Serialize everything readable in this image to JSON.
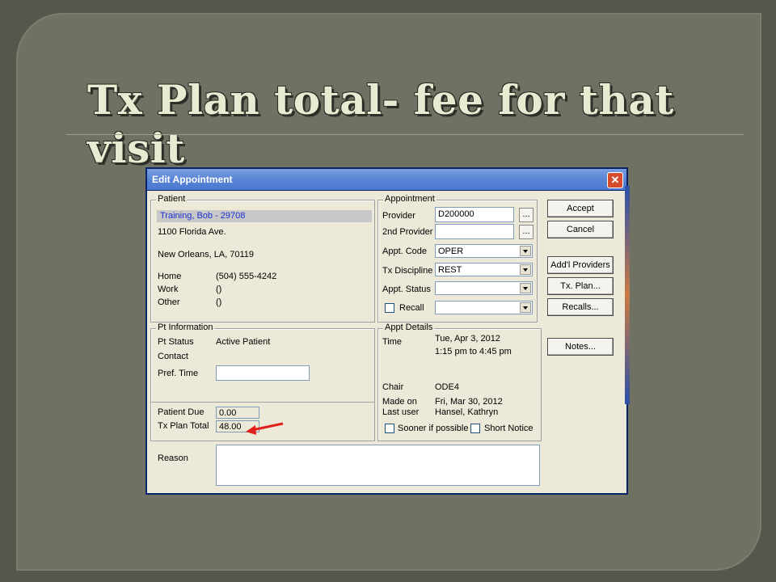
{
  "slide": {
    "title": "Tx Plan total- fee for that visit"
  },
  "dialog": {
    "title": "Edit Appointment",
    "patient": {
      "legend": "Patient",
      "name": "Training, Bob  - 29708",
      "address1": "1100 Florida Ave.",
      "address2": "New Orleans, LA, 70119",
      "home_label": "Home",
      "home_value": "(504) 555-4242",
      "work_label": "Work",
      "work_value": "()",
      "other_label": "Other",
      "other_value": "()"
    },
    "pt_info": {
      "legend": "Pt Information",
      "status_label": "Pt Status",
      "status_value": "Active Patient",
      "contact_label": "Contact",
      "pref_time_label": "Pref. Time",
      "pref_time_value": "",
      "patient_due_label": "Patient Due",
      "patient_due_value": "0.00",
      "tx_plan_total_label": "Tx Plan Total",
      "tx_plan_total_value": "48.00"
    },
    "appointment": {
      "legend": "Appointment",
      "provider_label": "Provider",
      "provider_value": "D200000",
      "provider2_label": "2nd Provider",
      "provider2_value": "",
      "appt_code_label": "Appt. Code",
      "appt_code_value": "OPER",
      "tx_discipline_label": "Tx Discipline",
      "tx_discipline_value": "REST",
      "appt_status_label": "Appt. Status",
      "appt_status_value": "",
      "recall_label": "Recall",
      "recall_value": "",
      "dots_label": "..."
    },
    "appt_details": {
      "legend": "Appt Details",
      "time_label": "Time",
      "time_date": "Tue, Apr 3, 2012",
      "time_range": "1:15 pm to 4:45 pm",
      "chair_label": "Chair",
      "chair_value": "ODE4",
      "made_on_label": "Made on",
      "made_on_value": "Fri, Mar 30, 2012",
      "last_user_label": "Last user",
      "last_user_value": "Hansel, Kathryn",
      "sooner_label": "Sooner if possible",
      "short_notice_label": "Short Notice"
    },
    "buttons": {
      "accept": "Accept",
      "cancel": "Cancel",
      "add_providers": "Add'l Providers",
      "tx_plan": "Tx. Plan...",
      "recalls": "Recalls...",
      "notes": "Notes..."
    },
    "reason": {
      "label": "Reason",
      "value": ""
    },
    "close_glyph": "✕"
  },
  "colors": {
    "arrow": "#e0201c",
    "highlight_text": "#1a2fd0"
  }
}
